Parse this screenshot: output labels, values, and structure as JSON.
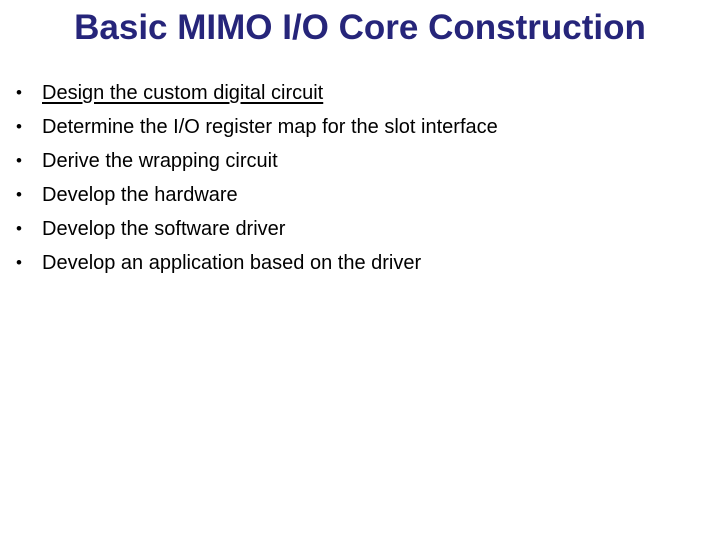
{
  "slide": {
    "title": "Basic MIMO I/O Core Construction",
    "title_color": "#26257a",
    "background_color": "#ffffff",
    "body_text_color": "#000000",
    "bullet_glyph": "•",
    "bullets": [
      {
        "text": "Design the custom digital circuit",
        "underlined": true
      },
      {
        "text": "Determine the I/O register map for the slot interface",
        "underlined": false
      },
      {
        "text": "Derive the wrapping circuit",
        "underlined": false
      },
      {
        "text": "Develop the hardware",
        "underlined": false
      },
      {
        "text": "Develop the software driver",
        "underlined": false
      },
      {
        "text": "Develop an application based on the driver",
        "underlined": false
      }
    ]
  }
}
